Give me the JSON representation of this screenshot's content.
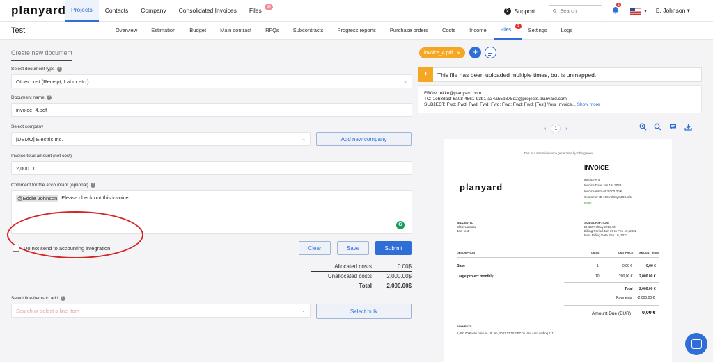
{
  "brand": "planyard",
  "topnav": [
    {
      "label": "Projects",
      "active": true
    },
    {
      "label": "Contacts"
    },
    {
      "label": "Company"
    },
    {
      "label": "Consolidated Invoices"
    },
    {
      "label": "Files",
      "badge": "99"
    }
  ],
  "topright": {
    "support_label": "Support",
    "search_placeholder": "Search",
    "notification_count": "1",
    "user_name": "E. Johnson"
  },
  "project_title": "Test",
  "tabs": [
    {
      "label": "Overview"
    },
    {
      "label": "Estimation"
    },
    {
      "label": "Budget"
    },
    {
      "label": "Main contract"
    },
    {
      "label": "RFQs"
    },
    {
      "label": "Subcontracts"
    },
    {
      "label": "Progress reports"
    },
    {
      "label": "Purchase orders"
    },
    {
      "label": "Costs"
    },
    {
      "label": "Income"
    },
    {
      "label": "Files",
      "active": true,
      "badge": "1"
    },
    {
      "label": "Settings"
    },
    {
      "label": "Logs"
    }
  ],
  "form": {
    "section_title": "Create new document",
    "doc_type_label": "Select document type",
    "doc_type_value": "Other cost (Receipt, Labor etc.)",
    "doc_name_label": "Document name",
    "doc_name_value": "invoice_4.pdf",
    "company_label": "Select company",
    "company_value": "[DEMO] Electric Inc.",
    "add_company_label": "Add new company",
    "total_label": "Invoice total amount (net cost)",
    "total_value": "2,000.00",
    "comment_label": "Comment for the accountant (optional)",
    "comment_mention": "@Eddie Johnson",
    "comment_text": "Please check out this invoice",
    "no_send_label": "Do not send to accounting integration",
    "clear_label": "Clear",
    "save_label": "Save",
    "submit_label": "Submit",
    "allocated_label": "Allocated costs",
    "allocated_value": "0.00$",
    "unallocated_label": "Unallocated costs",
    "unallocated_value": "2,000.00$",
    "sum_label": "Total",
    "sum_value": "2,000.00$",
    "lineitems_label": "Select line-items to add",
    "lineitems_placeholder": "Search or select a line-item",
    "select_bulk_label": "Select bulk"
  },
  "file": {
    "chip": "invoice_4.pdf",
    "warning": "This file has been uploaded multiple times, but is unmapped.",
    "from": "FROM: ekke@planyard.com",
    "to": "TO: 1eb8dacf-6a08-4561-93b1-a34a55b875d2@projects.planyard.com",
    "subject": "SUBJECT: Fwd: Fwd: Fwd: Fwd: Fwd: Fwd: Fwd: Fwd: [Test] Your Invoice...",
    "show_more": "Show more",
    "page": "1"
  },
  "invoice": {
    "note": "This is a sample invoice generated by Chargebee",
    "title": "INVOICE",
    "number": "Invoice #  4",
    "date": "Invoice Date  Jan 19, 2022",
    "amount": "Invoice Amount  2,000.00 €",
    "customer": "Customer ID  199YslSuymtO94eb",
    "status": "PAID",
    "logo": "planyard",
    "billed_to_h": "BILLED TO",
    "billed_to_1": "Ekke Uustalu",
    "billed_to_2": "Jani test",
    "sub_h": "SUBSCRIPTION",
    "sub_id": "ID  199YslSuyoRtjC4rk",
    "sub_period": "Billing Period  Jan 19 to Feb 19, 2022",
    "sub_next": "Next Billing Date  Feb 19, 2022",
    "col_desc": "DESCRIPTION",
    "col_units": "UNITS",
    "col_price": "UNIT PRICE",
    "col_amount": "AMOUNT (EUR)",
    "rows": [
      {
        "desc": "Base",
        "units": "1",
        "price": "0,00 €",
        "amount": "0,00 €"
      },
      {
        "desc": "Large project monthly",
        "units": "10",
        "price": "200,00 €",
        "amount": "2,000.00 €"
      }
    ],
    "total_label": "Total",
    "total_value": "2,000.00 €",
    "payments_label": "Payments",
    "payments_value": "-2,000.00 €",
    "due_label": "Amount Due (EUR)",
    "due_value": "0,00 €",
    "payments_h": "PAYMENTS",
    "payment_line": "2,000.00 € was paid on 19 Jan, 2022 17:10 CET by Visa card ending 1111."
  }
}
